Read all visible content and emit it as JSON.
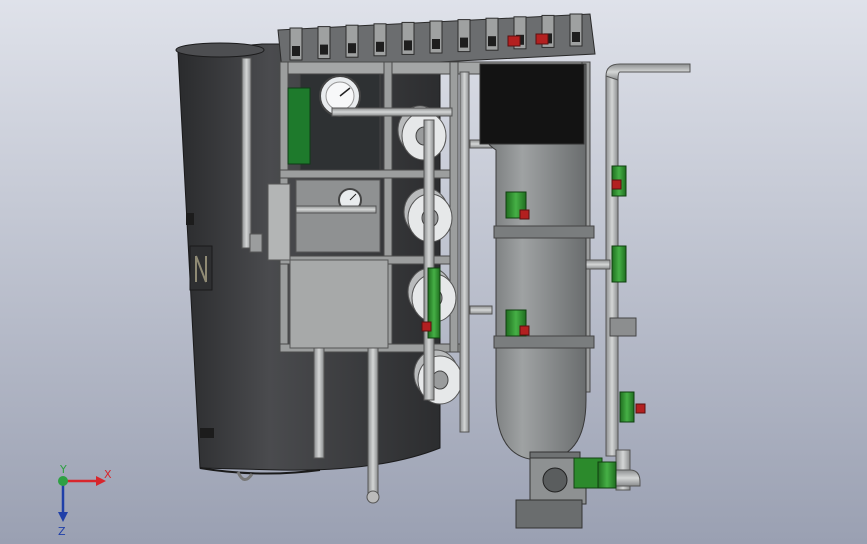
{
  "viewport": {
    "background_top": "#dfe2ea",
    "background_bottom": "#9aa0b2"
  },
  "triad": {
    "x_label": "X",
    "y_label": "Y",
    "z_label": "Z",
    "x_color": "#d8262c",
    "y_color": "#2ea043",
    "z_color": "#1f3fa8"
  },
  "model": {
    "tank_color": "#3a3b3d",
    "frame_color": "#9a9c9a",
    "pipe_color": "#a8aaab",
    "valve_color": "#2f8f2f",
    "handle_color": "#b32020",
    "vessel_top_color": "#121212",
    "vessel_color": "#8a8d8e"
  }
}
